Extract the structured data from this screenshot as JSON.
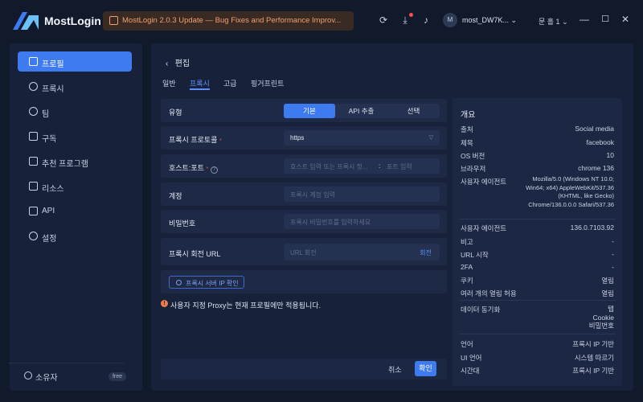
{
  "app": {
    "brand": "MostLogin",
    "notice": "MostLogin 2.0.3 Update — Bug Fixes and Performance Improv...",
    "user_initial": "M",
    "user_name": "most_DW7K...",
    "lang": "문 홀 1"
  },
  "sidebar": {
    "items": [
      {
        "label": "프로필",
        "icon": "profile-icon"
      },
      {
        "label": "프록시",
        "icon": "proxy-icon"
      },
      {
        "label": "팀",
        "icon": "team-icon"
      },
      {
        "label": "구독",
        "icon": "subscription-icon"
      },
      {
        "label": "추천 프로그램",
        "icon": "thumbs-up-icon"
      },
      {
        "label": "리소스",
        "icon": "resource-icon"
      },
      {
        "label": "API",
        "icon": "api-icon"
      },
      {
        "label": "설정",
        "icon": "settings-icon"
      }
    ],
    "owner": "소유자",
    "plan": "free"
  },
  "main": {
    "back_label": "편집",
    "tabs": [
      "일반",
      "프록시",
      "고급",
      "핑거프린트"
    ],
    "type_label": "유형",
    "type_options": [
      "기본",
      "API 추출",
      "선택"
    ],
    "protocol_label": "프록시 프로토콜",
    "protocol_value": "https",
    "host_label": "호스트:포트",
    "host_placeholder": "호스트 입력 또는 프록시 정...",
    "host_colon": ":",
    "port_placeholder": "포트 입력",
    "account_label": "계정",
    "account_placeholder": "프록시 계정 입력",
    "password_label": "비밀번호",
    "password_placeholder": "프록시 비밀번호를 입력하세요",
    "rotate_label": "프록시 회전 URL",
    "rotate_placeholder": "URL 회전",
    "rotate_button": "회전",
    "check_button": "프록시 서버 IP 확인",
    "warning": "사용자 지정 Proxy는 현재 프로필에만 적용됩니다.",
    "cancel": "취소",
    "confirm": "확인",
    "required_mark": "*",
    "help_mark": "?"
  },
  "overview": {
    "title": "개요",
    "rows": [
      {
        "k": "출처",
        "v": "Social media"
      },
      {
        "k": "제목",
        "v": "facebook"
      },
      {
        "k": "OS 버전",
        "v": "10"
      },
      {
        "k": "브라우저",
        "v": "chrome  136"
      }
    ],
    "ua_label": "사용자 에이전트",
    "ua_value": "Mozilla/5.0 (Windows NT 10.0; Win64; x64) AppleWebKit/537.36 (KHTML, like Gecko) Chrome/136.0.0.0 Safari/537.36",
    "rows2": [
      {
        "k": "사용자 에이전트",
        "v": "136.0.7103.92"
      },
      {
        "k": "비고",
        "v": "-"
      },
      {
        "k": "URL 시작",
        "v": "-"
      },
      {
        "k": "2FA",
        "v": "-"
      },
      {
        "k": "쿠키",
        "v": "열림"
      },
      {
        "k": "여러 개의 열림 허용",
        "v": "열림"
      }
    ],
    "sync_label": "데이터 동기화",
    "sync_values": [
      "탭",
      "Cookie",
      "비밀번호"
    ],
    "rows3": [
      {
        "k": "언어",
        "v": "프록시 IP 기반"
      },
      {
        "k": "UI 언어",
        "v": "시스템 따르기"
      },
      {
        "k": "시간대",
        "v": "프록시 IP 기반"
      }
    ]
  },
  "colors": {
    "accent": "#3f7bf0",
    "background": "#111a2b",
    "panel": "#17223a"
  }
}
